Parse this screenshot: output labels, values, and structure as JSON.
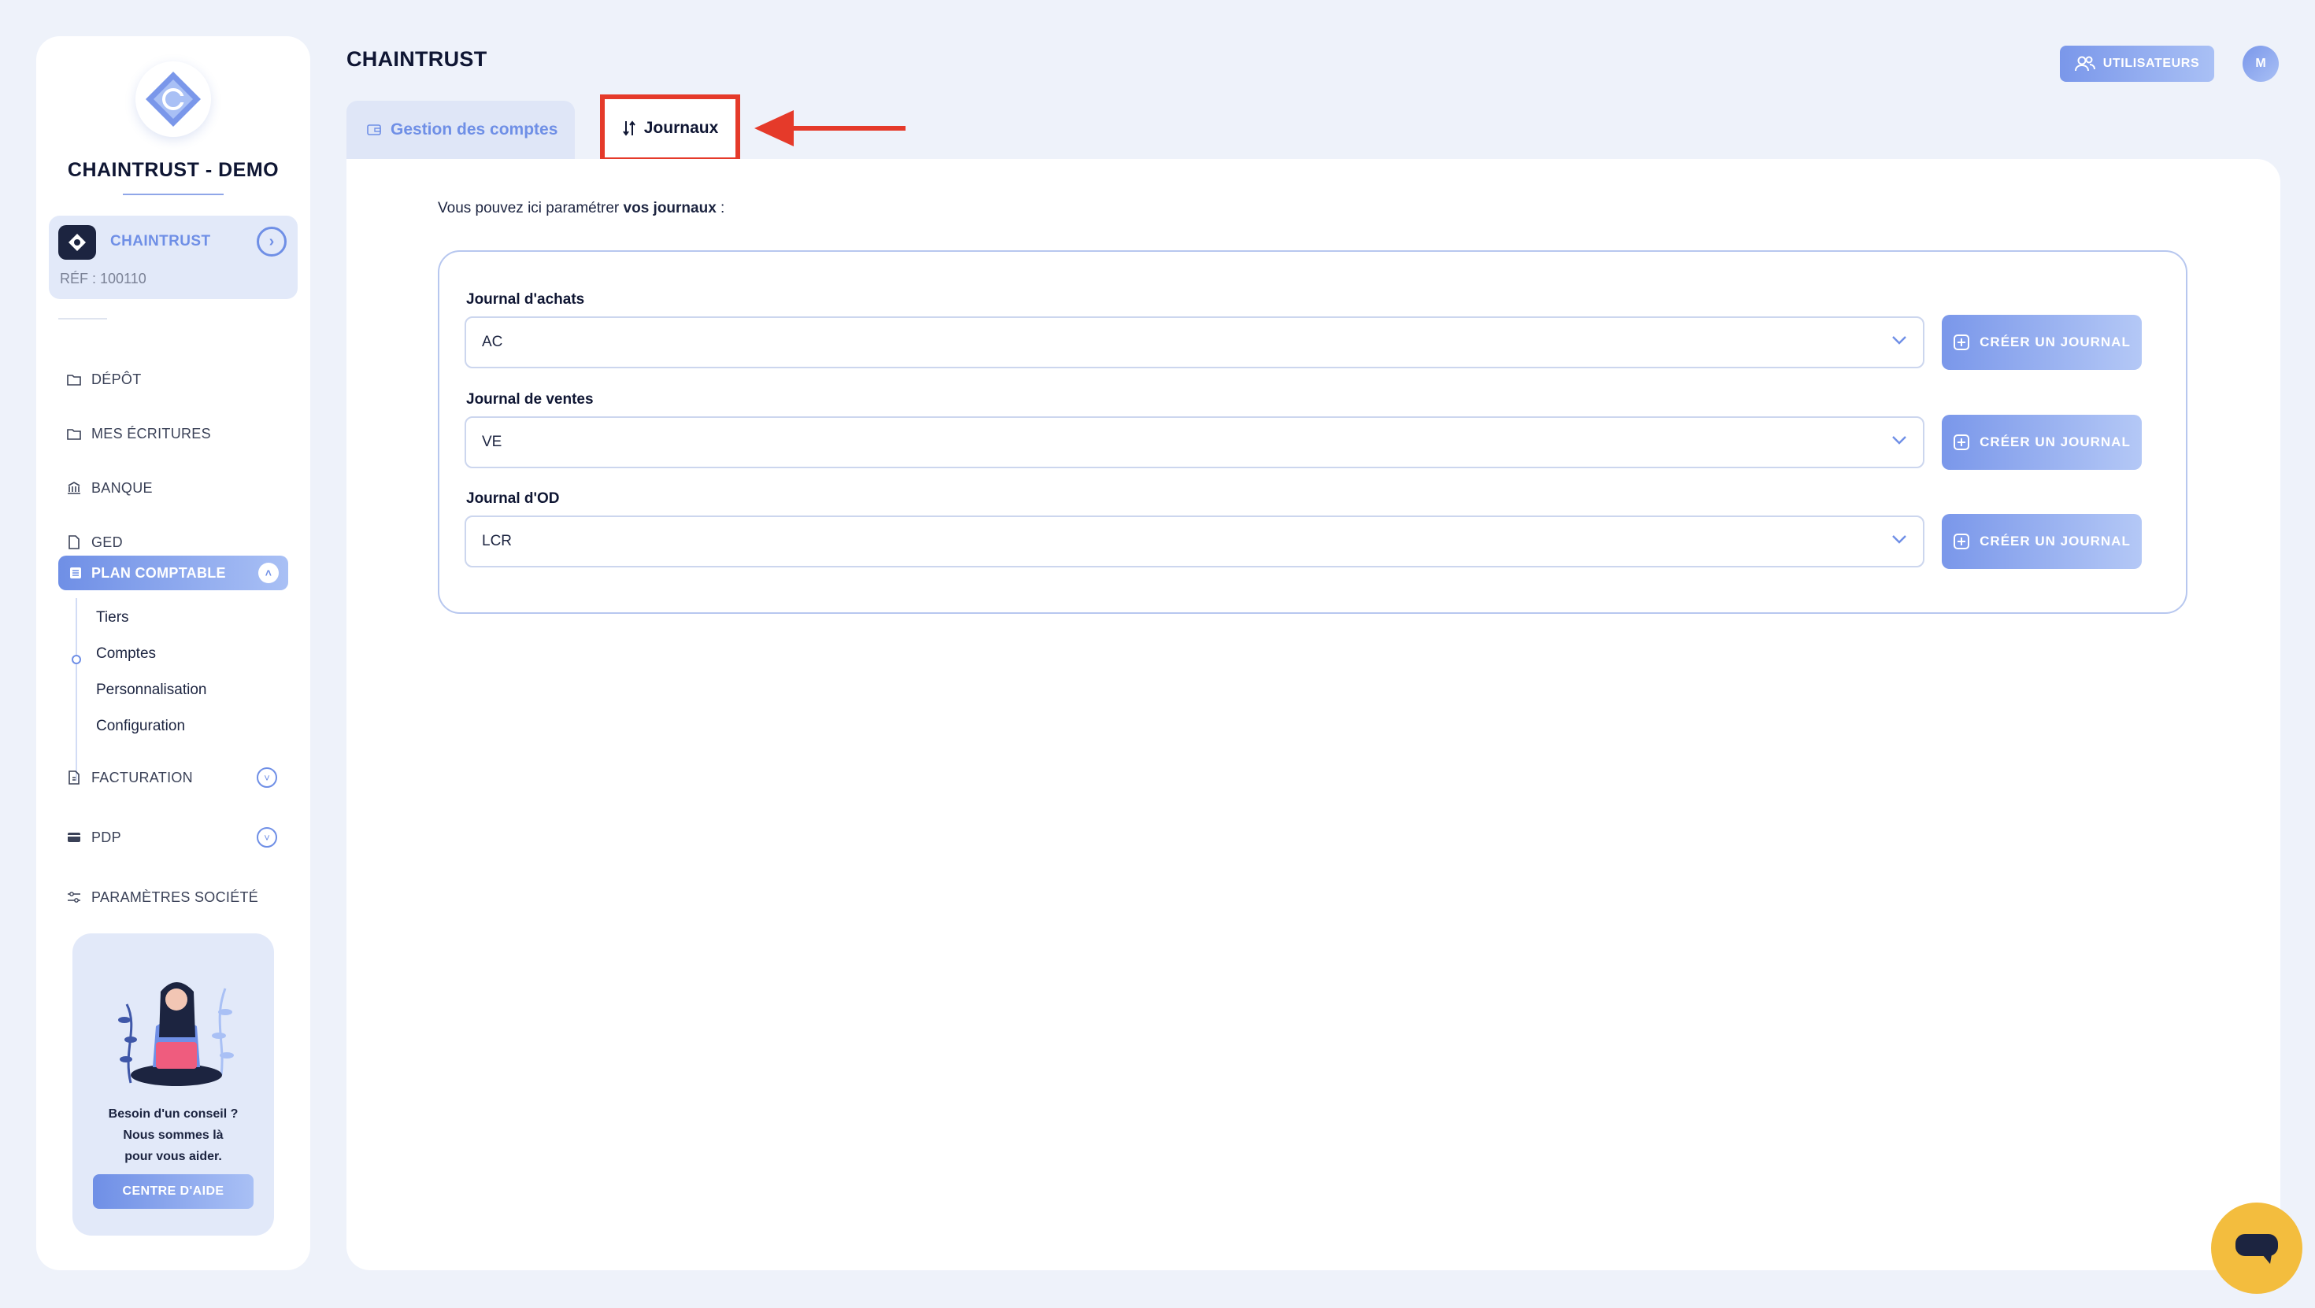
{
  "app": {
    "title": "CHAINTRUST",
    "users_button": "UTILISATEURS",
    "avatar_initial": "M"
  },
  "sidebar": {
    "company_title": "CHAINTRUST - DEMO",
    "company": {
      "name": "CHAINTRUST",
      "ref": "RÉF : 100110"
    },
    "items": [
      {
        "label": "DÉPÔT",
        "icon": "folder-icon"
      },
      {
        "label": "MES ÉCRITURES",
        "icon": "folder-icon"
      },
      {
        "label": "BANQUE",
        "icon": "bank-icon"
      },
      {
        "label": "GED",
        "icon": "document-icon"
      },
      {
        "label": "PLAN COMPTABLE",
        "icon": "list-icon",
        "active": true
      },
      {
        "label": "FACTURATION",
        "icon": "invoice-icon"
      },
      {
        "label": "PDP",
        "icon": "card-icon"
      },
      {
        "label": "PARAMÈTRES SOCIÉTÉ",
        "icon": "sliders-icon"
      }
    ],
    "subitems": [
      "Tiers",
      "Comptes",
      "Personnalisation",
      "Configuration"
    ],
    "help": {
      "line1": "Besoin d'un conseil ?",
      "line2": "Nous sommes là",
      "line3": "pour vous aider.",
      "button": "CENTRE D'AIDE"
    }
  },
  "tabs": [
    {
      "label": "Gestion des comptes",
      "icon": "wallet-icon"
    },
    {
      "label": "Journaux",
      "icon": "sort-icon",
      "active": true
    }
  ],
  "main": {
    "intro_prefix": "Vous pouvez ici paramétrer ",
    "intro_bold": "vos journaux",
    "intro_suffix": " :",
    "fields": [
      {
        "label": "Journal d'achats",
        "value": "AC",
        "button": "CRÉER UN JOURNAL"
      },
      {
        "label": "Journal de ventes",
        "value": "VE",
        "button": "CRÉER UN JOURNAL"
      },
      {
        "label": "Journal d'OD",
        "value": "LCR",
        "button": "CRÉER UN JOURNAL"
      }
    ]
  },
  "colors": {
    "accent": "#6f8fe6",
    "highlight_box": "#e53a2a",
    "chat_button": "#f3bd3e",
    "background": "#eef2fa"
  }
}
